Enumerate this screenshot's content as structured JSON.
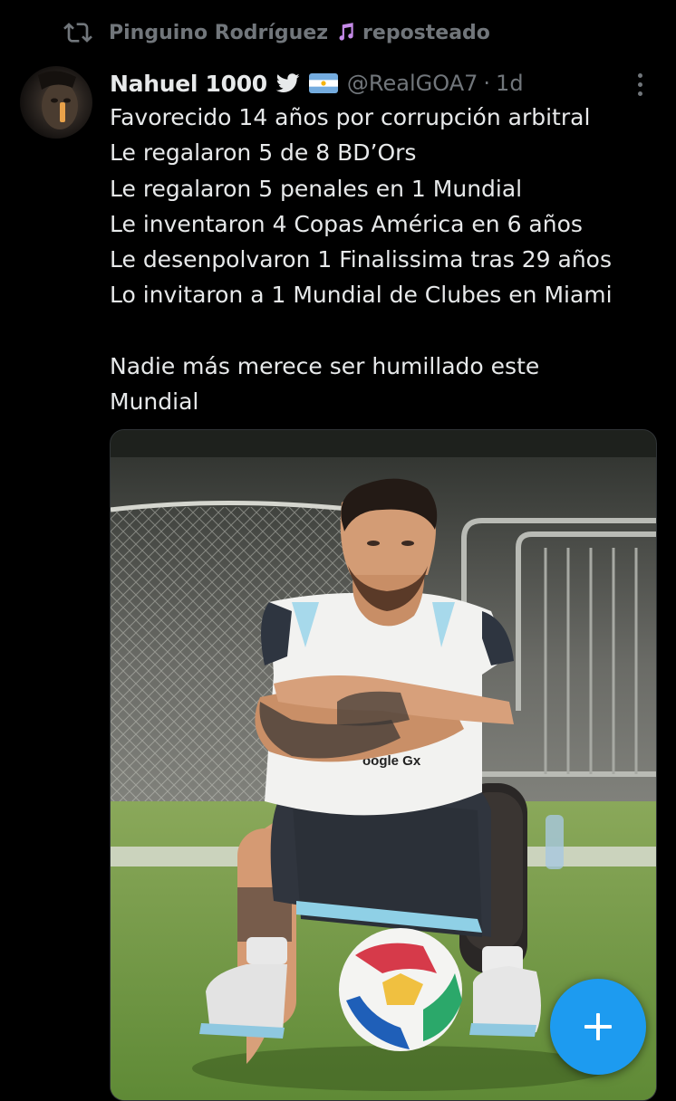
{
  "repost": {
    "user": "Pinguino Rodríguez",
    "label": "reposteado",
    "icon": "repost-icon",
    "emoji_icon": "musical-notes-icon"
  },
  "tweet": {
    "author_name": "Nahuel 1000",
    "handle": "@RealGOA7",
    "separator": "·",
    "time": "1d",
    "lines": [
      "Favorecido 14 años por corrupción arbitral",
      "Le regalaron 5 de 8 BD’Ors",
      "Le regalaron 5 penales en 1 Mundial",
      "Le inventaron 4 Copas América en 6 años",
      "Le desenpolvaron 1 Finalissima tras 29 años",
      "Lo invitaron a 1 Mundial de Clubes en Miami",
      "",
      "Nadie más merece ser humillado este",
      "Mundial"
    ],
    "icons": [
      "twitter-bird-icon",
      "argentina-flag-icon",
      "more-options-icon"
    ]
  },
  "media": {
    "description_icon": "photo",
    "jersey_text": "oogle Gx"
  },
  "fab": {
    "icon": "plus-icon"
  },
  "colors": {
    "background": "#000000",
    "text": "#e7e9ea",
    "secondary": "#71767b",
    "accent": "#1d9bf0"
  }
}
